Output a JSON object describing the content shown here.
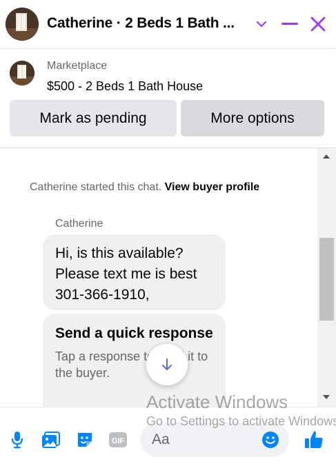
{
  "header": {
    "title": "Catherine · 2 Beds 1 Bath ..."
  },
  "listing": {
    "marketplace_label": "Marketplace",
    "price_title": "$500 - 2 Beds 1 Bath House",
    "mark_pending_label": "Mark as pending",
    "more_options_label": "More options"
  },
  "chat": {
    "started_text": "Catherine started this chat.",
    "view_profile_link": "View buyer profile",
    "sender_name": "Catherine",
    "message_lines": [
      "Hi, is this available?",
      "Please text me is best",
      "301-366-1910,"
    ],
    "quick_response_title": "Send a quick response",
    "quick_response_subtitle": "Tap a response to send it to the buyer."
  },
  "composer": {
    "placeholder": "Aa"
  },
  "watermark": {
    "line1": "Activate Windows",
    "line2": "Go to Settings to activate Windows."
  },
  "colors": {
    "accent": "#0084ff",
    "header_icons": "#a334fa",
    "bubble_bg": "#f0f0f0",
    "button_bg": "#e4e6eb"
  },
  "icons": [
    "chevron-down-icon",
    "minimize-icon",
    "close-icon",
    "arrow-down-icon",
    "microphone-icon",
    "photo-icon",
    "sticker-icon",
    "gif-icon",
    "emoji-icon",
    "like-icon"
  ]
}
